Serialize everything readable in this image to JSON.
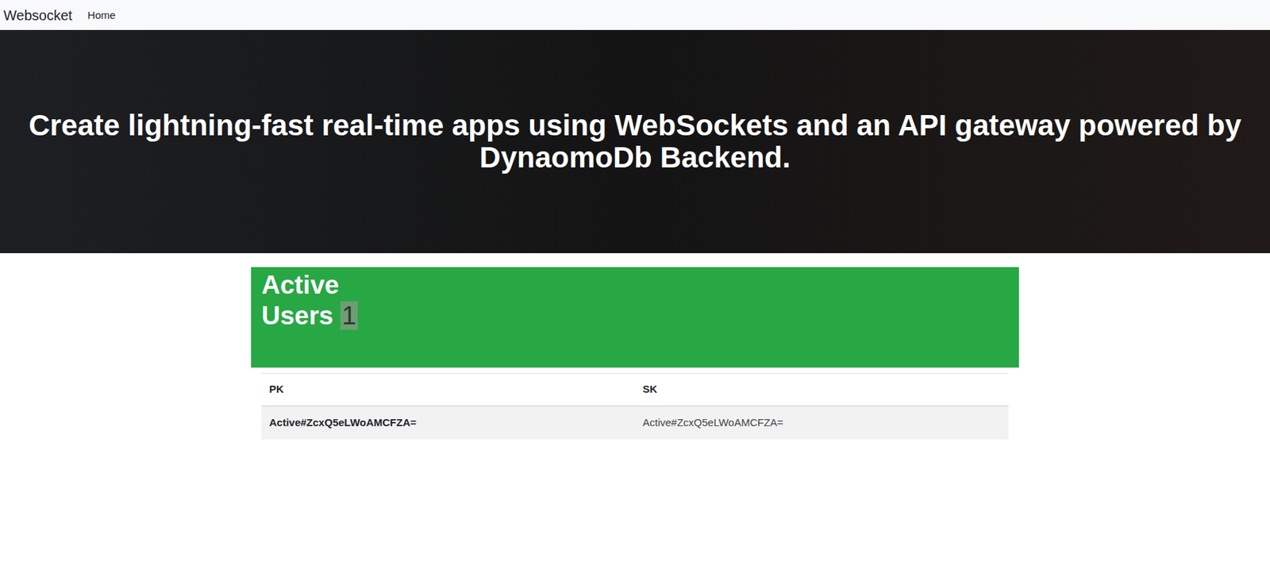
{
  "navbar": {
    "brand": "Websocket",
    "items": [
      {
        "label": "Home",
        "selected": true
      }
    ]
  },
  "hero": {
    "title": "Create lightning-fast real-time apps using WebSockets and an API gateway powered by DynaomoDb Backend."
  },
  "card": {
    "label": "Active Users",
    "count": "1"
  },
  "table": {
    "columns": [
      "PK",
      "SK"
    ],
    "rows": [
      [
        "Active#ZcxQ5eLWoAMCFZA=",
        "Active#ZcxQ5eLWoAMCFZA="
      ]
    ]
  }
}
